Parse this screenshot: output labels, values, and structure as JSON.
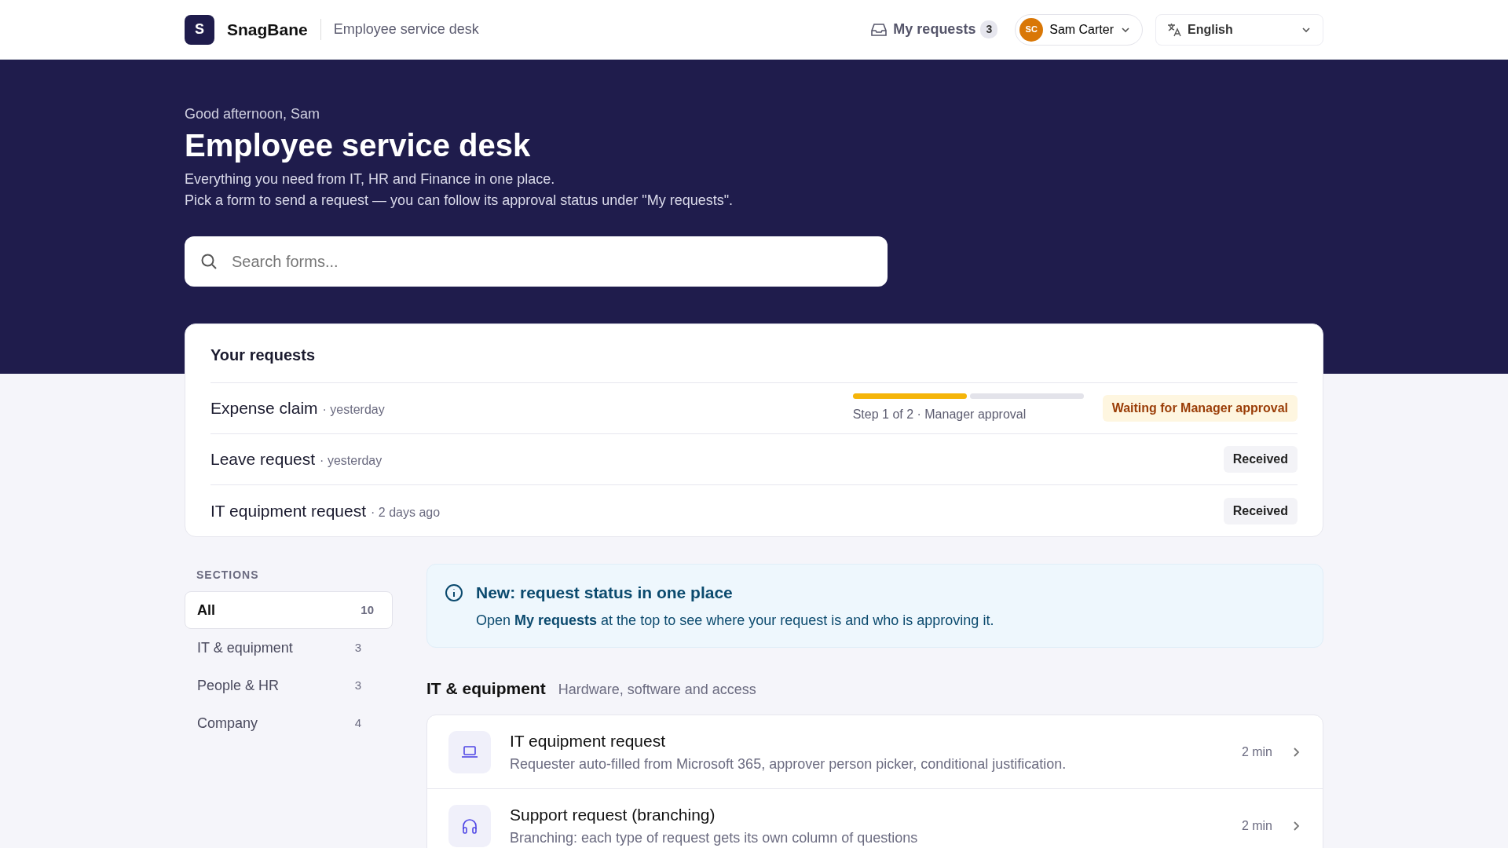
{
  "header": {
    "logo_letter": "S",
    "brand": "SnagBane",
    "subtitle": "Employee service desk",
    "my_requests": {
      "label": "My requests",
      "count": "3"
    },
    "user": {
      "initials": "SC",
      "name": "Sam Carter"
    },
    "language": "English"
  },
  "hero": {
    "greeting": "Good afternoon, Sam",
    "title": "Employee service desk",
    "lines": [
      "Everything you need from IT, HR and Finance in one place.",
      "Pick a form to send a request — you can follow its approval status under \"My requests\"."
    ],
    "search": {
      "placeholder": "Search forms..."
    }
  },
  "your_requests": {
    "title": "Your requests",
    "rows": [
      {
        "name": "Expense claim",
        "when": "· yesterday",
        "status": "Waiting for Manager approval",
        "kind": "pending",
        "steps": [
          {
            "done": true
          },
          {
            "done": false
          }
        ],
        "step_text": "Step 1 of 2 · Manager approval"
      },
      {
        "name": "Leave request",
        "when": "· yesterday",
        "status": "Received",
        "kind": "received"
      },
      {
        "name": "IT equipment request",
        "when": "· 2 days ago",
        "status": "Received",
        "kind": "received"
      }
    ]
  },
  "sidebar": {
    "heading": "SECTIONS",
    "items": [
      {
        "label": "All",
        "count": "10",
        "selected": true
      },
      {
        "label": "IT & equipment",
        "count": "3",
        "selected": false
      },
      {
        "label": "People & HR",
        "count": "3",
        "selected": false
      },
      {
        "label": "Company",
        "count": "4",
        "selected": false
      }
    ]
  },
  "notice": {
    "title": "New: request status in one place",
    "text": "Open **My requests** at the top to see where your request is and who is approving it."
  },
  "section": {
    "title": "IT & equipment",
    "subtitle": "Hardware, software and access",
    "forms": [
      {
        "title": "IT equipment request",
        "description": "Requester auto-filled from Microsoft 365, approver person picker, conditional justification.",
        "time": "2 min"
      },
      {
        "title": "Support request (branching)",
        "description": "Branching: each type of request gets its own column of questions",
        "time": "2 min"
      }
    ]
  }
}
